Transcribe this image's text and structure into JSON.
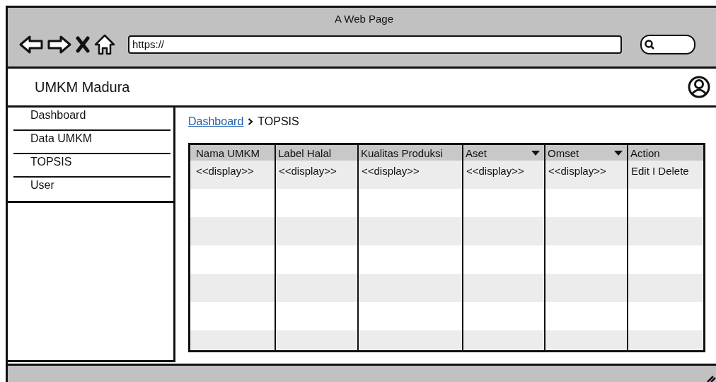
{
  "window": {
    "title": "A Web Page"
  },
  "address_bar": {
    "value": "https://"
  },
  "header": {
    "app_name": "UMKM Madura"
  },
  "sidebar": {
    "items": [
      {
        "label": "Dashboard"
      },
      {
        "label": "Data UMKM"
      },
      {
        "label": "TOPSIS"
      },
      {
        "label": "User"
      }
    ]
  },
  "breadcrumb": {
    "link": "Dashboard",
    "current": "TOPSIS"
  },
  "table": {
    "columns": [
      {
        "label": "Nama UMKM",
        "dropdown": false
      },
      {
        "label": "Label Halal",
        "dropdown": false
      },
      {
        "label": "Kualitas Produksi",
        "dropdown": false
      },
      {
        "label": "Aset",
        "dropdown": true
      },
      {
        "label": "Omset",
        "dropdown": true
      },
      {
        "label": "Action",
        "dropdown": false
      }
    ],
    "rows": [
      [
        "<<display>>",
        "<<display>>",
        "<<display>>",
        "<<display>>",
        "<<display>>",
        "Edit I Delete"
      ]
    ]
  }
}
